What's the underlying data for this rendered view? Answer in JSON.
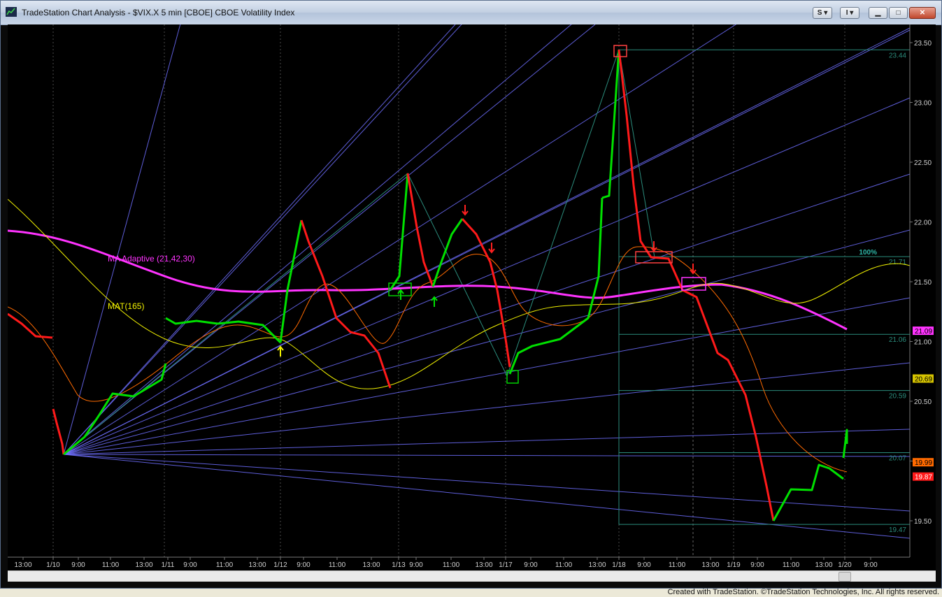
{
  "window": {
    "title": "TradeStation Chart Analysis - $VIX.X 5 min [CBOE] CBOE Volatility Index",
    "buttons": {
      "s_label": "S",
      "i_label": "I",
      "minimize": "▁",
      "maximize": "□",
      "close": "✕"
    }
  },
  "chart": {
    "symbol": "$VIX.X",
    "interval": "5 min",
    "exchange": "CBOE",
    "name": "CBOE Volatility Index",
    "indicators": {
      "ma_adaptive_label": "MA Adaptive (21,42,30)",
      "mat_label": "MAT(165)"
    },
    "colors": {
      "up": "#00e000",
      "down": "#ff1a1a",
      "ma_adaptive": "#ff33ff",
      "mat": "#f2f200",
      "fast_ma": "#ff6a00",
      "gann": "#6f6fff",
      "fib": "#2b8c7c"
    },
    "fib_levels": [
      "23.44",
      "21.71",
      "21.06",
      "20.59",
      "20.07",
      "19.47"
    ],
    "fib_percent_label": "100%",
    "price_axis": [
      "23.50",
      "23.00",
      "22.50",
      "22.00",
      "21.50",
      "21.00",
      "20.50",
      "20.00",
      "19.50"
    ],
    "price_badges": [
      {
        "label": "21.09",
        "bg": "#ff33ff",
        "fg": "#000000"
      },
      {
        "label": "20.69",
        "bg": "#d6c400",
        "fg": "#000000"
      },
      {
        "label": "19.99",
        "bg": "#ff6a00",
        "fg": "#000000"
      },
      {
        "label": "19.87",
        "bg": "#ff1a1a",
        "fg": "#ffffff"
      }
    ],
    "time_axis": [
      "13:00",
      "1/10",
      "9:00",
      "11:00",
      "13:00",
      "1/11",
      "9:00",
      "11:00",
      "13:00",
      "1/12",
      "9:00",
      "11:00",
      "13:00",
      "1/13",
      "9:00",
      "11:00",
      "13:00",
      "1/17",
      "9:00",
      "11:00",
      "13:00",
      "1/18",
      "9:00",
      "11:00",
      "13:00",
      "1/19",
      "9:00",
      "11:00",
      "13:00",
      "1/20",
      "9:00"
    ]
  },
  "footer": {
    "credit": "Created with TradeStation. ©TradeStation Technologies, Inc. All rights reserved."
  }
}
